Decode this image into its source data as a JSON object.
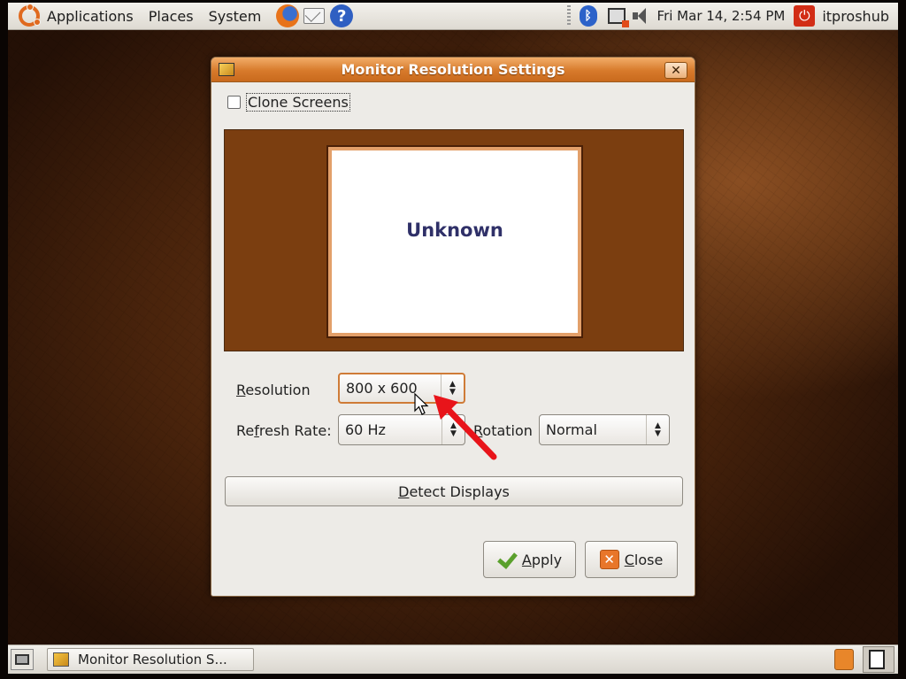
{
  "top_panel": {
    "menus": [
      "Applications",
      "Places",
      "System"
    ],
    "clock": "Fri Mar 14,  2:54 PM",
    "user": "itproshub"
  },
  "dialog": {
    "title": "Monitor Resolution Settings",
    "close_symbol": "✕",
    "clone_screens_label": "Clone Screens",
    "clone_screens_checked": false,
    "monitor_name": "Unknown",
    "resolution": {
      "label_prefix": "R",
      "label_rest": "esolution",
      "value": "800 x 600"
    },
    "refresh_rate": {
      "label_prefix": "Re",
      "label_ul": "f",
      "label_rest": "resh Rate:",
      "value": "60 Hz"
    },
    "rotation": {
      "label_ul": "R",
      "label_rest": "otation",
      "value": "Normal"
    },
    "detect_button": {
      "ul": "D",
      "rest": "etect Displays"
    },
    "apply_button": {
      "ul": "A",
      "rest": "pply"
    },
    "close_button": {
      "ul": "C",
      "rest": "lose"
    }
  },
  "taskbar": {
    "task_label": "Monitor Resolution S..."
  },
  "colors": {
    "titlebar": "#d77a2b",
    "preview_bg": "#7b3e10",
    "annotation_arrow": "#e8141a"
  }
}
